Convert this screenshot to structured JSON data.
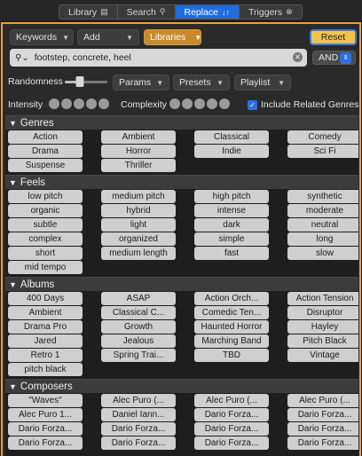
{
  "tabs": [
    {
      "label": "Library",
      "icon": "▤"
    },
    {
      "label": "Search",
      "icon": "⚲"
    },
    {
      "label": "Replace",
      "icon": "↓↑"
    },
    {
      "label": "Triggers",
      "icon": "⊗"
    }
  ],
  "active_tab": "Replace",
  "toolbar": {
    "keywords_label": "Keywords",
    "add_label": "Add",
    "libraries_label": "Libraries",
    "reset_label": "Reset"
  },
  "search": {
    "value": "footstep, concrete, heel",
    "operator": "AND"
  },
  "controls": {
    "randomness_label": "Randomness",
    "randomness_level": 0.35,
    "params_label": "Params",
    "presets_label": "Presets",
    "playlist_label": "Playlist",
    "intensity_label": "Intensity",
    "complexity_label": "Complexity",
    "include_related_label": "Include Related Genres",
    "include_related_checked": true
  },
  "sections": [
    {
      "title": "Genres",
      "items": [
        "Action",
        "Ambient",
        "Classical",
        "Comedy",
        "Drama",
        "Horror",
        "Indie",
        "Sci Fi",
        "Suspense",
        "Thriller"
      ]
    },
    {
      "title": "Feels",
      "items": [
        "low pitch",
        "medium pitch",
        "high pitch",
        "synthetic",
        "organic",
        "hybrid",
        "intense",
        "moderate",
        "subtle",
        "light",
        "dark",
        "neutral",
        "complex",
        "organized",
        "simple",
        "long",
        "short",
        "medium length",
        "fast",
        "slow",
        "mid tempo"
      ]
    },
    {
      "title": "Albums",
      "items": [
        "400 Days",
        "ASAP",
        "Action Orch...",
        "Action Tension",
        "Ambient",
        "Classical C...",
        "Comedic Ten...",
        "Disruptor",
        "Drama Pro",
        "Growth",
        "Haunted Horror",
        "Hayley",
        "Jared",
        "Jealous",
        "Marching Band",
        "Pitch Black",
        "Retro 1",
        "Spring Trai...",
        "TBD",
        "Vintage",
        "pitch black"
      ]
    },
    {
      "title": "Composers",
      "items": [
        "\"Waves\"",
        "Alec Puro (...",
        "Alec Puro (...",
        "Alec Puro (...",
        "Alec Puro 1...",
        "Daniel Iann...",
        "Dario Forza...",
        "Dario Forza...",
        "Dario Forza...",
        "Dario Forza...",
        "Dario Forza...",
        "Dario Forza...",
        "Dario Forza...",
        "Dario Forza...",
        "Dario Forza...",
        "Dario Forza..."
      ]
    }
  ],
  "colors": {
    "accent": "#1f6de0",
    "panel_border": "#e7a23a",
    "reset": "#f2c34a",
    "libraries": "#c98a2a"
  }
}
